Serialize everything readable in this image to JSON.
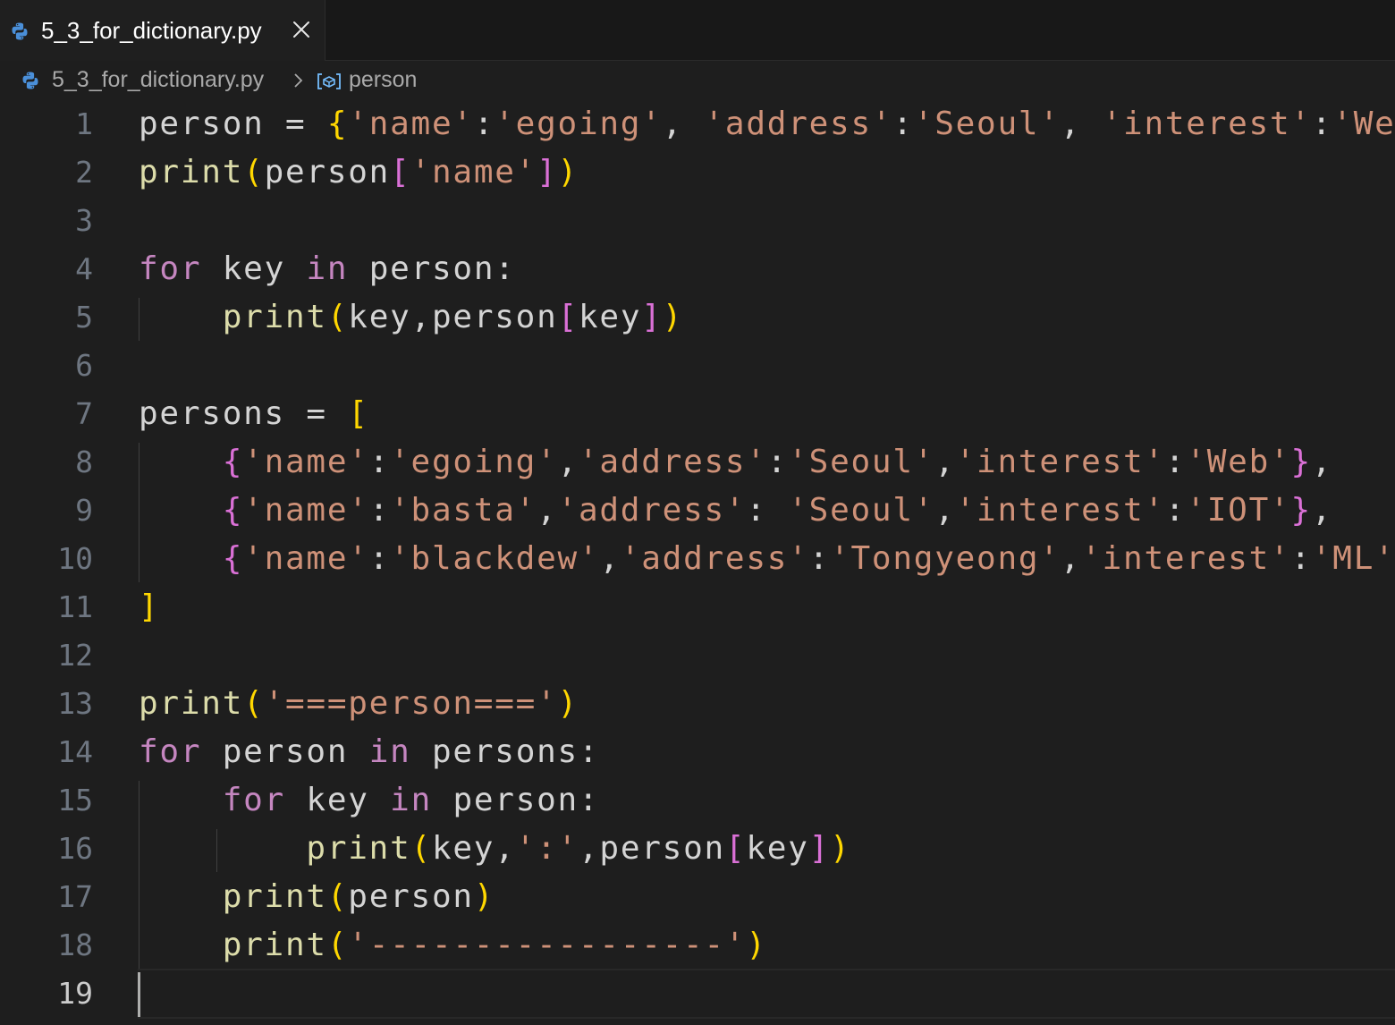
{
  "tab": {
    "label": "5_3_for_dictionary.py"
  },
  "breadcrumb": {
    "file": "5_3_for_dictionary.py",
    "symbol": "person"
  },
  "editor": {
    "active_line": 19,
    "lines": [
      {
        "num": "1",
        "text": "person = {'name':'egoing', 'address':'Seoul', 'interest':'Web'}"
      },
      {
        "num": "2",
        "text": "print(person['name'])"
      },
      {
        "num": "3",
        "text": ""
      },
      {
        "num": "4",
        "text": "for key in person:"
      },
      {
        "num": "5",
        "text": "    print(key,person[key])"
      },
      {
        "num": "6",
        "text": ""
      },
      {
        "num": "7",
        "text": "persons = ["
      },
      {
        "num": "8",
        "text": "    {'name':'egoing','address':'Seoul','interest':'Web'},"
      },
      {
        "num": "9",
        "text": "    {'name':'basta','address': 'Seoul','interest':'IOT'},"
      },
      {
        "num": "10",
        "text": "    {'name':'blackdew','address':'Tongyeong','interest':'ML'}"
      },
      {
        "num": "11",
        "text": "]"
      },
      {
        "num": "12",
        "text": ""
      },
      {
        "num": "13",
        "text": "print('===person===')"
      },
      {
        "num": "14",
        "text": "for person in persons:"
      },
      {
        "num": "15",
        "text": "    for key in person:"
      },
      {
        "num": "16",
        "text": "        print(key,':',person[key])"
      },
      {
        "num": "17",
        "text": "    print(person)"
      },
      {
        "num": "18",
        "text": "    print('-----------------')"
      },
      {
        "num": "19",
        "text": ""
      }
    ]
  },
  "colors": {
    "keyword": "#c586c0",
    "function": "#dcdcaa",
    "string": "#ce9178",
    "bracket_level1": "#ffd700",
    "bracket_level2": "#da70d6",
    "variable": "#d4d4d4",
    "background": "#1e1e1e",
    "python_icon_blue": "#4a8fd9",
    "symbol_icon": "#75beff"
  },
  "icons": {
    "tab_file": "python-icon",
    "tab_close": "close-icon",
    "breadcrumb_file": "python-icon",
    "breadcrumb_separator": "chevron-right-icon",
    "breadcrumb_symbol": "symbol-variable-icon"
  }
}
